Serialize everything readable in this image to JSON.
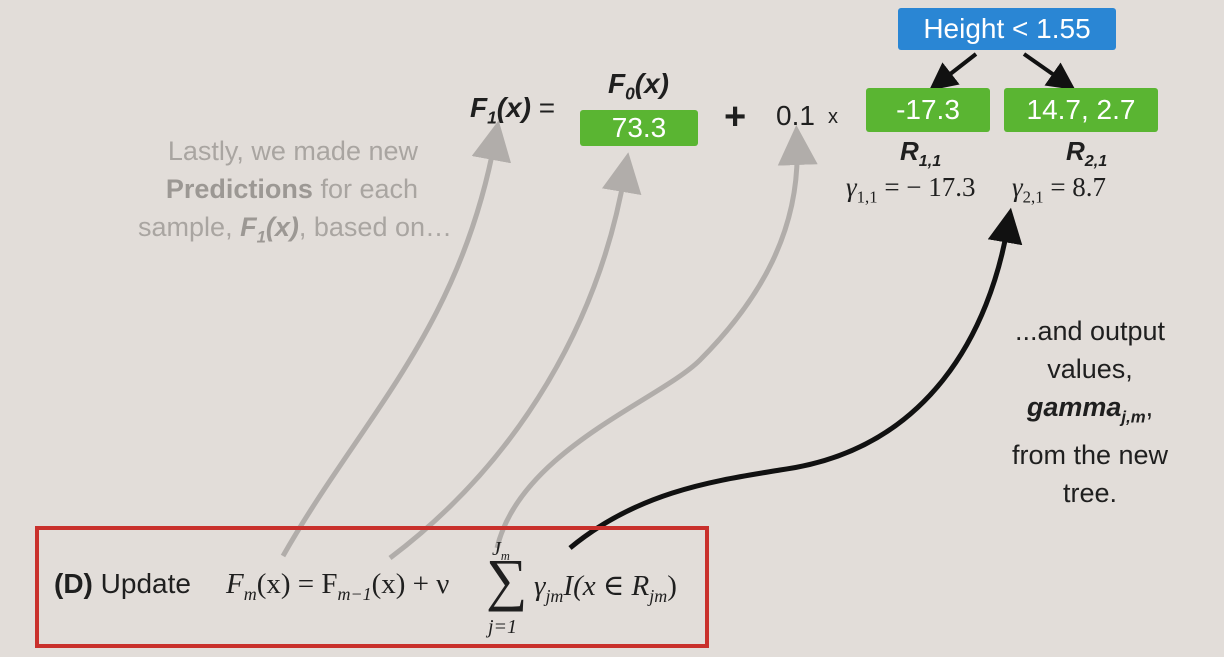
{
  "tree": {
    "root_label": "Height < 1.55",
    "left_leaf": "-17.3",
    "right_leaf": "14.7, 2.7",
    "left_region": "R",
    "left_region_sub": "1,1",
    "right_region": "R",
    "right_region_sub": "2,1",
    "left_gamma_sym": "γ",
    "left_gamma_sub": "1,1",
    "left_gamma_rest": " = − 17.3",
    "right_gamma_sym": "γ",
    "right_gamma_sub": "2,1",
    "right_gamma_rest": " = 8.7"
  },
  "equation": {
    "lhs_f": "F",
    "lhs_sub": "1",
    "lhs_x": "(x)",
    "equals": "=",
    "f0_f": "F",
    "f0_sub": "0",
    "f0_x": "(x)",
    "f0_value": "73.3",
    "plus": "+",
    "learning_rate": "0.1",
    "times": "x"
  },
  "left_note": {
    "line1": "Lastly, we made new",
    "line2_bold": "Predictions",
    "line2_rest": " for each",
    "line3_pre": "sample, ",
    "line3_f": "F",
    "line3_sub": "1",
    "line3_x": "(x)",
    "line3_post": ", based on…"
  },
  "right_note": {
    "line1": "...and output",
    "line2": "values,",
    "line3_bold": "gamma",
    "line3_sub": "j,m",
    "line3_comma": ",",
    "line4": "from the new",
    "line5": "tree."
  },
  "update_box": {
    "label": "(D)",
    "word": "Update",
    "formula_lhs": "F",
    "formula_lhs_sub": "m",
    "formula_lhs_x": "(x) = F",
    "formula_prev_sub": "m−1",
    "formula_prev_x": "(x) + ν",
    "sum_top": "J",
    "sum_top_sub": "m",
    "sum_symbol": "∑",
    "sum_bottom": "j=1",
    "term_gamma": "γ",
    "term_gamma_sub": "jm",
    "term_rest": "I(x ∈ R",
    "term_r_sub": "jm",
    "term_close": ")"
  },
  "colors": {
    "background": "#e2ddd9",
    "green": "#5ab532",
    "blue": "#2a86d4",
    "red_border": "#c9302c",
    "gray_arrow": "#b1adaa",
    "black_arrow": "#111111"
  }
}
